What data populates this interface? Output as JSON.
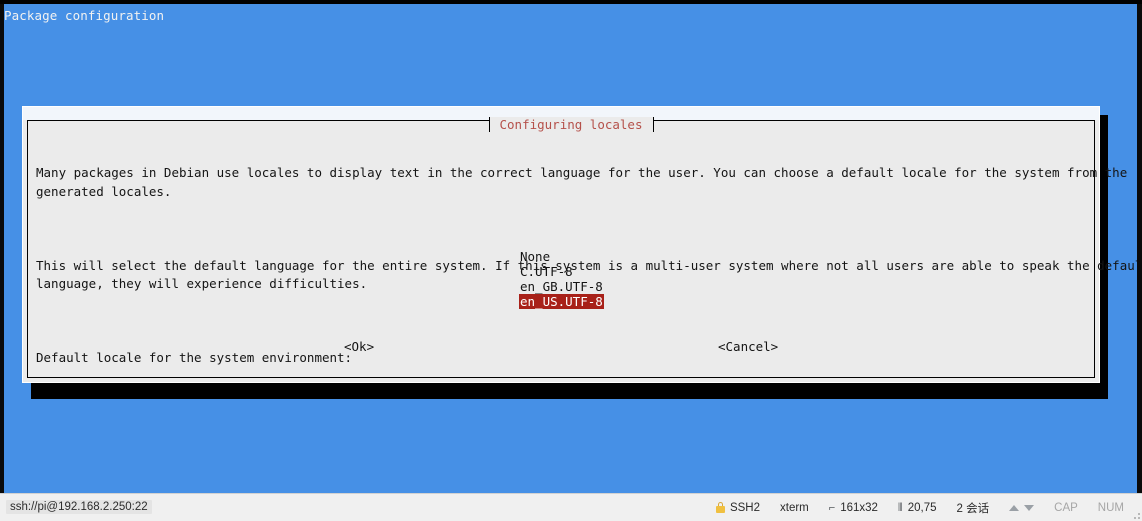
{
  "window": {
    "header_line": "Package configuration"
  },
  "dialog": {
    "title": "Configuring locales",
    "paragraphs": [
      "Many packages in Debian use locales to display text in the correct language for the user. You can choose a default locale for the system from the\ngenerated locales.",
      "This will select the default language for the entire system. If this system is a multi-user system where not all users are able to speak the default\nlanguage, they will experience difficulties.",
      "Default locale for the system environment:"
    ],
    "locales": [
      {
        "label": "None",
        "selected": false
      },
      {
        "label": "C.UTF-8",
        "selected": false
      },
      {
        "label": "en_GB.UTF-8",
        "selected": false
      },
      {
        "label": "en_US.UTF-8",
        "selected": true
      }
    ],
    "buttons": {
      "ok": "<Ok>",
      "cancel": "<Cancel>"
    },
    "colors": {
      "title_text": "#b5504a",
      "selection_bg": "#a82119",
      "selection_fg": "#ffffff",
      "dialog_bg": "#ebebeb",
      "terminal_bg": "#4690e6"
    }
  },
  "statusbar": {
    "connection": "ssh://pi@192.168.2.250:22",
    "protocol": "SSH2",
    "terminal_type": "xterm",
    "screen_size": "161x32",
    "cursor_position": "20,75",
    "sessions": "2 会话",
    "caps_lock": "CAP",
    "num_lock": "NUM",
    "icons": {
      "lock": "lock-icon",
      "screen_size": "screen-size-icon",
      "cursor": "cursor-position-icon",
      "upload": "upload-arrow-icon",
      "download": "download-arrow-icon"
    }
  }
}
